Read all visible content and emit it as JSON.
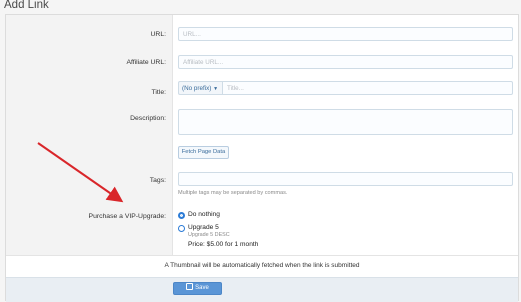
{
  "page": {
    "title": "Add Link"
  },
  "form": {
    "url": {
      "label": "URL:",
      "placeholder": "URL..."
    },
    "affiliate_url": {
      "label": "Affiliate URL:",
      "placeholder": "Affiliate URL..."
    },
    "title": {
      "label": "Title:",
      "prefix_value": "(No prefix)",
      "placeholder": "Title..."
    },
    "description": {
      "label": "Description:"
    },
    "fetch_button": "Fetch Page Data",
    "tags": {
      "label": "Tags:",
      "hint": "Multiple tags may be separated by commas."
    },
    "vip": {
      "label": "Purchase a VIP-Upgrade:",
      "options": [
        {
          "label": "Do nothing",
          "selected": true
        },
        {
          "label": "Upgrade 5",
          "desc": "Upgrade 5 DESC",
          "price": "Price: $5.00 for 1 month",
          "selected": false
        }
      ]
    },
    "notice": "A Thumbnail will be automatically fetched when the link is submitted",
    "save_label": "Save"
  },
  "colors": {
    "accent": "#2b7bd6",
    "arrow": "#d9262a"
  },
  "icons": {
    "prefix_caret": "caret-down-icon",
    "save": "save-icon"
  }
}
